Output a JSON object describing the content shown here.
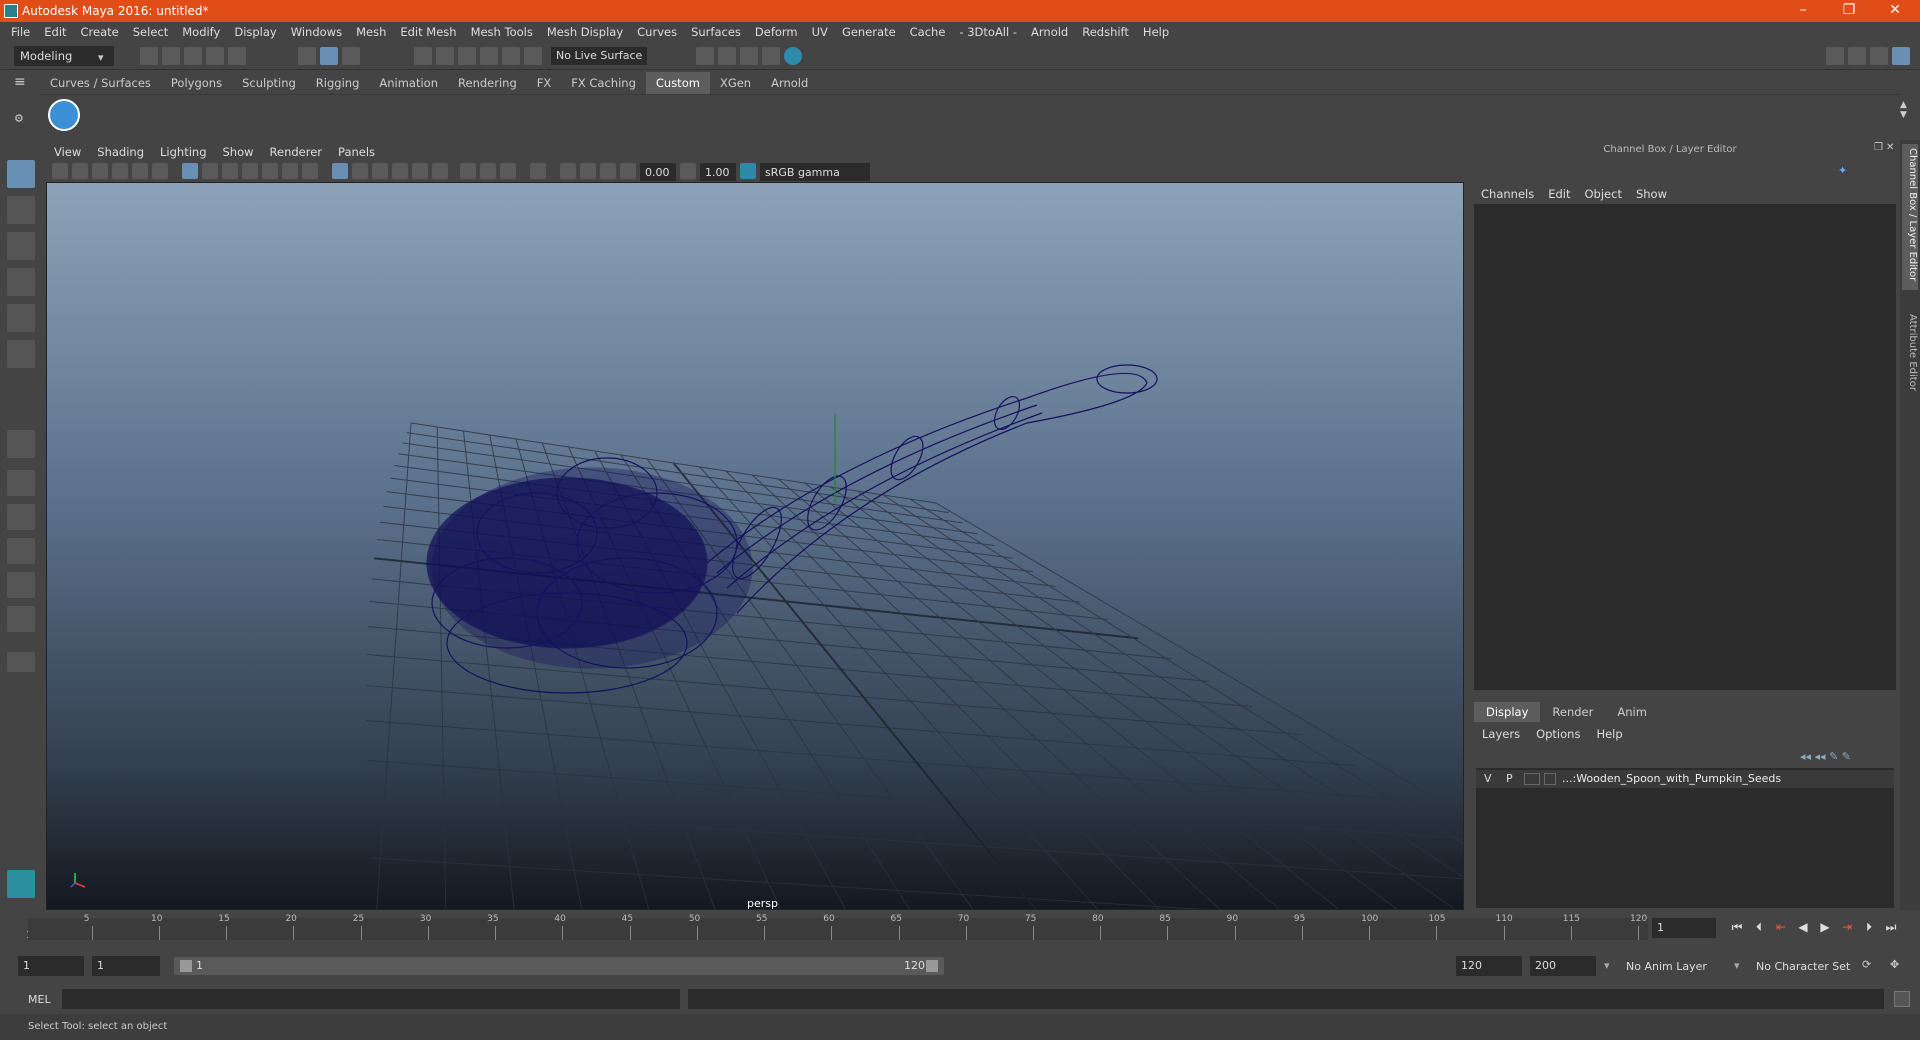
{
  "titlebar": {
    "title": "Autodesk Maya 2016: untitled*"
  },
  "menubar": {
    "items": [
      "File",
      "Edit",
      "Create",
      "Select",
      "Modify",
      "Display",
      "Windows",
      "Mesh",
      "Edit Mesh",
      "Mesh Tools",
      "Mesh Display",
      "Curves",
      "Surfaces",
      "Deform",
      "UV",
      "Generate",
      "Cache",
      "- 3DtoAll -",
      "Arnold",
      "Redshift",
      "Help"
    ]
  },
  "statusline": {
    "mode": "Modeling",
    "live_surface": "No Live Surface"
  },
  "shelf": {
    "tabs": [
      "Curves / Surfaces",
      "Polygons",
      "Sculpting",
      "Rigging",
      "Animation",
      "Rendering",
      "FX",
      "FX Caching",
      "Custom",
      "XGen",
      "Arnold"
    ],
    "active_tab": "Custom"
  },
  "panel": {
    "menu": [
      "View",
      "Shading",
      "Lighting",
      "Show",
      "Renderer",
      "Panels"
    ],
    "exposure": "0.00",
    "gamma": "1.00",
    "colorspace": "sRGB gamma",
    "camera_label": "persp"
  },
  "channelbox": {
    "title": "Channel Box / Layer Editor",
    "menu": [
      "Channels",
      "Edit",
      "Object",
      "Show"
    ],
    "layer_tabs": [
      "Display",
      "Render",
      "Anim"
    ],
    "active_layer_tab": "Display",
    "layer_menu": [
      "Layers",
      "Options",
      "Help"
    ],
    "layer": {
      "v": "V",
      "p": "P",
      "name": "...:Wooden_Spoon_with_Pumpkin_Seeds"
    }
  },
  "sidetabs": [
    "Channel Box / Layer Editor",
    "Attribute Editor"
  ],
  "timeline": {
    "ticks": [
      "5",
      "10",
      "15",
      "20",
      "25",
      "30",
      "35",
      "40",
      "45",
      "50",
      "55",
      "60",
      "65",
      "70",
      "75",
      "80",
      "85",
      "90",
      "95",
      "100",
      "105",
      "110",
      "115",
      "120"
    ],
    "start_marker": "1",
    "current_frame": "1"
  },
  "range": {
    "start_time": "1",
    "playback_start": "1",
    "slider_start": "1",
    "slider_end": "120",
    "playback_end": "120",
    "end_time": "200",
    "anim_layer": "No Anim Layer",
    "character_set": "No Character Set"
  },
  "cmdline": {
    "label": "MEL"
  },
  "helpline": {
    "text": "Select Tool: select an object"
  }
}
